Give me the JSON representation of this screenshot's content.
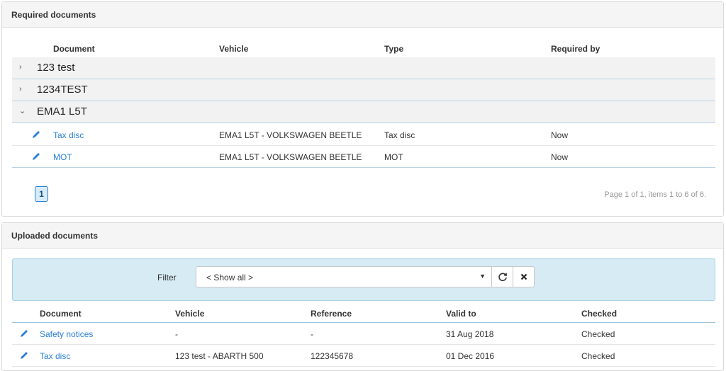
{
  "required": {
    "title": "Required documents",
    "columns": {
      "document": "Document",
      "vehicle": "Vehicle",
      "type": "Type",
      "required_by": "Required by"
    },
    "groups": [
      {
        "label": "123 test",
        "expanded": false
      },
      {
        "label": "1234TEST",
        "expanded": false
      },
      {
        "label": "EMA1 L5T",
        "expanded": true
      }
    ],
    "rows": [
      {
        "document": "Tax disc",
        "vehicle": "EMA1 L5T - VOLKSWAGEN BEETLE",
        "type": "Tax disc",
        "required_by": "Now"
      },
      {
        "document": "MOT",
        "vehicle": "EMA1 L5T - VOLKSWAGEN BEETLE",
        "type": "MOT",
        "required_by": "Now"
      }
    ],
    "pager": {
      "current_page": "1",
      "info": "Page 1 of 1, items 1 to 6 of 6."
    }
  },
  "uploaded": {
    "title": "Uploaded documents",
    "filter": {
      "label": "Filter",
      "value": "< Show all >"
    },
    "columns": {
      "document": "Document",
      "vehicle": "Vehicle",
      "reference": "Reference",
      "valid_to": "Valid to",
      "checked": "Checked"
    },
    "rows": [
      {
        "document": "Safety notices",
        "vehicle": "-",
        "reference": "-",
        "valid_to": "31 Aug 2018",
        "checked": "Checked"
      },
      {
        "document": "Tax disc",
        "vehicle": "123 test - ABARTH 500",
        "reference": "122345678",
        "valid_to": "01 Dec 2016",
        "checked": "Checked"
      }
    ]
  },
  "icons": {
    "edit": "pencil-icon",
    "expand": "chevron-right-icon",
    "collapse": "chevron-down-icon",
    "refresh": "refresh-icon",
    "clear": "close-icon",
    "dropdown": "caret-down-icon"
  },
  "colors": {
    "link": "#2a7fd4",
    "filter_bg": "#d6ebf4",
    "group_bg": "#f2f2f2"
  }
}
